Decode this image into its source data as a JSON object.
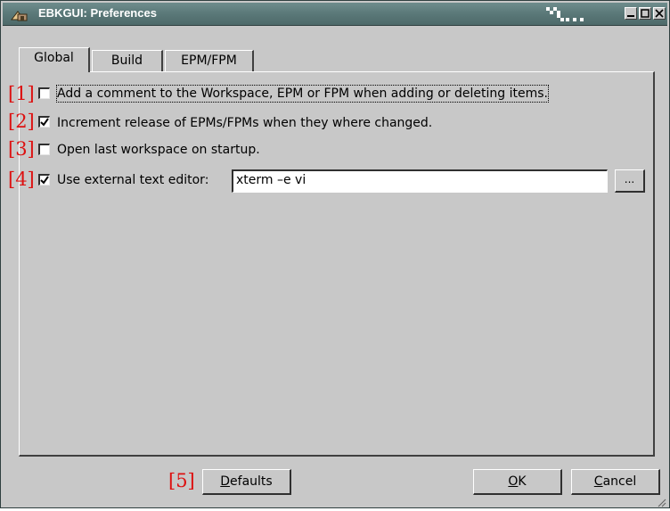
{
  "window": {
    "title": "EBKGUI: Preferences",
    "titlebar_color": "#5a7878"
  },
  "tabs": [
    {
      "label": "Global",
      "active": true
    },
    {
      "label": "Build",
      "active": false
    },
    {
      "label": "EPM/FPM",
      "active": false
    }
  ],
  "options": [
    {
      "marker": "[1]",
      "checked": false,
      "label": "Add a comment to the Workspace, EPM or FPM when adding or deleting items."
    },
    {
      "marker": "[2]",
      "checked": true,
      "label": "Increment release of EPMs/FPMs when they where changed."
    },
    {
      "marker": "[3]",
      "checked": false,
      "label": "Open last workspace on startup."
    },
    {
      "marker": "[4]",
      "checked": true,
      "label": "Use external text editor:"
    }
  ],
  "editor": {
    "value": "xterm –e vi",
    "browse_label": "..."
  },
  "buttons": {
    "defaults_marker": "[5]",
    "defaults_mnemonic": "D",
    "defaults_rest": "efaults",
    "ok_mnemonic": "O",
    "ok_rest": "K",
    "cancel_mnemonic": "C",
    "cancel_rest": "ancel"
  },
  "colors": {
    "marker": "#dd1111",
    "background": "#c8c8c8"
  }
}
